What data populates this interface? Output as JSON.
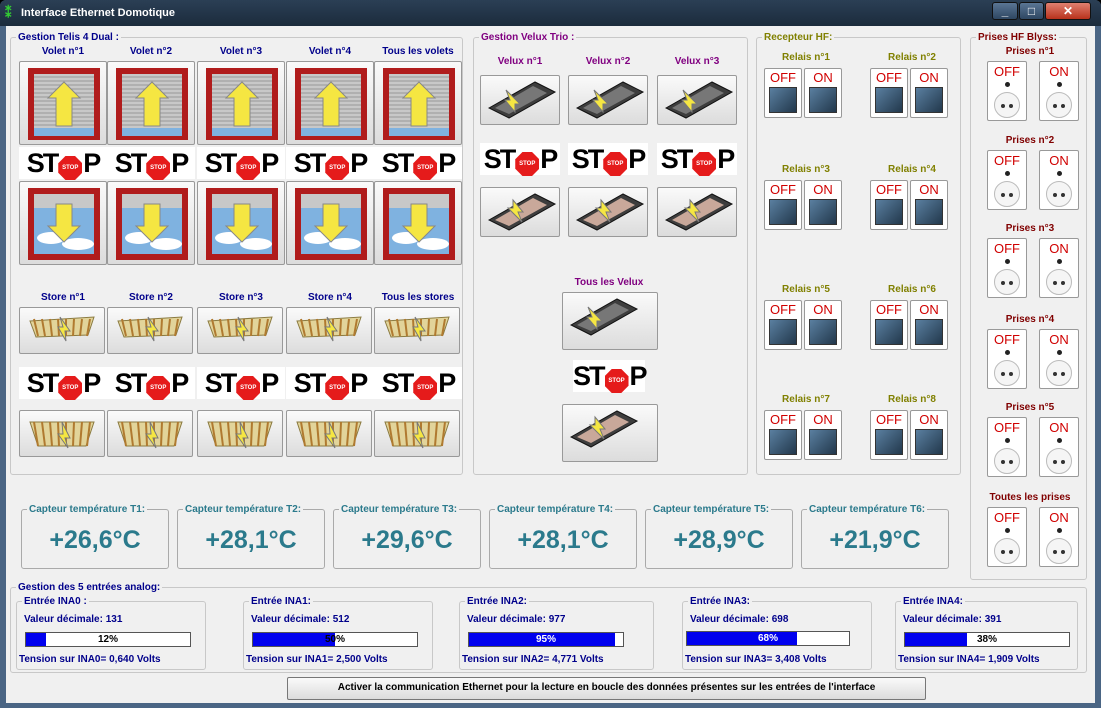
{
  "window": {
    "title": "Interface Ethernet Domotique"
  },
  "volets": {
    "group_title": "Gestion Telis 4 Dual :",
    "labels": [
      "Volet n°1",
      "Volet n°2",
      "Volet n°3",
      "Volet n°4",
      "Tous les volets"
    ]
  },
  "stores": {
    "labels": [
      "Store n°1",
      "Store n°2",
      "Store n°3",
      "Store n°4",
      "Tous les stores"
    ]
  },
  "velux": {
    "group_title": "Gestion Velux Trio :",
    "labels": [
      "Velux n°1",
      "Velux n°2",
      "Velux n°3"
    ],
    "all_label": "Tous les Velux"
  },
  "recepteur": {
    "group_title": "Recepteur HF:",
    "relais": [
      "Relais n°1",
      "Relais n°2",
      "Relais n°3",
      "Relais n°4",
      "Relais n°5",
      "Relais n°6",
      "Relais n°7",
      "Relais n°8"
    ],
    "off": "OFF",
    "on": "ON"
  },
  "prises": {
    "group_title": "Prises HF Blyss:",
    "labels": [
      "Prises n°1",
      "Prises n°2",
      "Prises n°3",
      "Prises n°4",
      "Prises n°5",
      "Toutes les prises"
    ],
    "off": "OFF",
    "on": "ON"
  },
  "stop_letters": {
    "s": "ST",
    "p": "P",
    "sign": "STOP"
  },
  "capteurs": [
    {
      "label": "Capteur température T1:",
      "value": "+26,6°C"
    },
    {
      "label": "Capteur température T2:",
      "value": "+28,1°C"
    },
    {
      "label": "Capteur température T3:",
      "value": "+29,6°C"
    },
    {
      "label": "Capteur température T4:",
      "value": "+28,1°C"
    },
    {
      "label": "Capteur température T5:",
      "value": "+28,9°C"
    },
    {
      "label": "Capteur température T6:",
      "value": "+21,9°C"
    }
  ],
  "analog": {
    "group_title": "Gestion des 5 entrées analog:",
    "inputs": [
      {
        "title": "Entrée INA0 :",
        "decimal": "Valeur décimale: 131",
        "percent": 12,
        "percent_text": "12%",
        "tension": "Tension sur INA0= 0,640 Volts"
      },
      {
        "title": "Entrée INA1:",
        "decimal": "Valeur décimale: 512",
        "percent": 50,
        "percent_text": "50%",
        "tension": "Tension sur INA1= 2,500 Volts"
      },
      {
        "title": "Entrée INA2:",
        "decimal": "Valeur décimale: 977",
        "percent": 95,
        "percent_text": "95%",
        "tension": "Tension sur INA2= 4,771 Volts"
      },
      {
        "title": "Entrée INA3:",
        "decimal": "Valeur décimale: 698",
        "percent": 68,
        "percent_text": "68%",
        "tension": "Tension sur INA3= 3,408 Volts"
      },
      {
        "title": "Entrée INA4:",
        "decimal": "Valeur décimale: 391",
        "percent": 38,
        "percent_text": "38%",
        "tension": "Tension sur INA4= 1,909 Volts"
      }
    ]
  },
  "footer": {
    "button": "Activer la communication Ethernet pour la lecture en boucle des données présentes sur les entrées de l'interface"
  },
  "colors": {
    "accent_blue": "#0000ee",
    "temp_color": "#2b7a8c",
    "stop_red": "#e51b1b"
  }
}
